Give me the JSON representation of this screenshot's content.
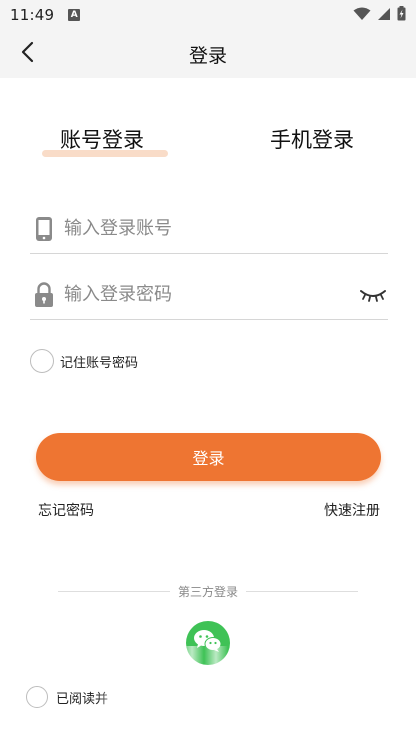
{
  "status_bar": {
    "time": "11:49",
    "notification_badge": "A",
    "icons": [
      "wifi-icon",
      "signal-icon",
      "battery-icon"
    ]
  },
  "nav": {
    "title": "登录",
    "back_icon": "chevron-left-icon"
  },
  "tabs": [
    {
      "label": "账号登录",
      "active": true
    },
    {
      "label": "手机登录",
      "active": false
    }
  ],
  "form": {
    "account_placeholder": "输入登录账号",
    "account_value": "",
    "password_placeholder": "输入登录密码",
    "password_value": "",
    "remember_label": "记住账号密码",
    "remember_checked": false
  },
  "actions": {
    "login_label": "登录",
    "forgot_label": "忘记密码",
    "register_label": "快速注册"
  },
  "third_party": {
    "label": "第三方登录",
    "providers": [
      "wechat-icon"
    ]
  },
  "agreement": {
    "label": "已阅读并",
    "checked": false
  },
  "colors": {
    "accent": "#ee7532",
    "tab_underline": "#f9dcc8",
    "wechat": "#3fc256",
    "bar_bg": "#f4f4f4"
  }
}
